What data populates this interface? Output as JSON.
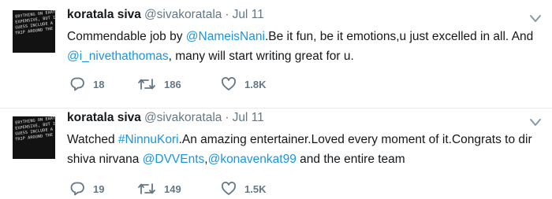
{
  "tweets": [
    {
      "avatar": {
        "lines": [
          "ERYTHING ON EARTH IS",
          "EXPENSIVE, BUT I",
          "GUESS INCLUDE A FREE",
          "TRIP AROUND THE SUN"
        ]
      },
      "author": {
        "name": "koratala siva",
        "handle": "@sivakoratala",
        "separator": "·",
        "date": "Jul 11"
      },
      "text_parts": [
        {
          "text": "Commendable job by ",
          "link": false
        },
        {
          "text": "@NameisNani",
          "link": true
        },
        {
          "text": ".Be it fun, be it emotions,u just excelled in all. And ",
          "link": false
        },
        {
          "text": "@i_nivethathomas",
          "link": true
        },
        {
          "text": ", many will start writing great for u.",
          "link": false
        }
      ],
      "actions": {
        "replies": "18",
        "retweets": "186",
        "likes": "1.8K"
      },
      "icons": [
        "reply-icon",
        "retweet-icon",
        "heart-icon",
        "chevron-down-icon"
      ]
    },
    {
      "avatar": {
        "lines": [
          "ERYTHING ON EARTH IS",
          "EXPENSIVE, BUT I",
          "GUESS INCLUDE A FREE",
          "TRIP AROUND THE SUN"
        ]
      },
      "author": {
        "name": "koratala siva",
        "handle": "@sivakoratala",
        "separator": "·",
        "date": "Jul 11"
      },
      "text_parts": [
        {
          "text": "Watched ",
          "link": false
        },
        {
          "text": "#NinnuKori",
          "link": true
        },
        {
          "text": ".An amazing entertainer.Loved every moment of it.Congrats to dir shiva nirvana ",
          "link": false
        },
        {
          "text": "@DVVEnts",
          "link": true
        },
        {
          "text": ",",
          "link": false
        },
        {
          "text": "@konavenkat99",
          "link": true
        },
        {
          "text": " and the entire team",
          "link": false
        }
      ],
      "actions": {
        "replies": "19",
        "retweets": "149",
        "likes": "1.5K"
      },
      "icons": [
        "reply-icon",
        "retweet-icon",
        "heart-icon",
        "chevron-down-icon"
      ]
    }
  ],
  "colors": {
    "text": "#14171a",
    "muted": "#657786",
    "link": "#1b95e0",
    "divider": "#e6ecf0"
  }
}
